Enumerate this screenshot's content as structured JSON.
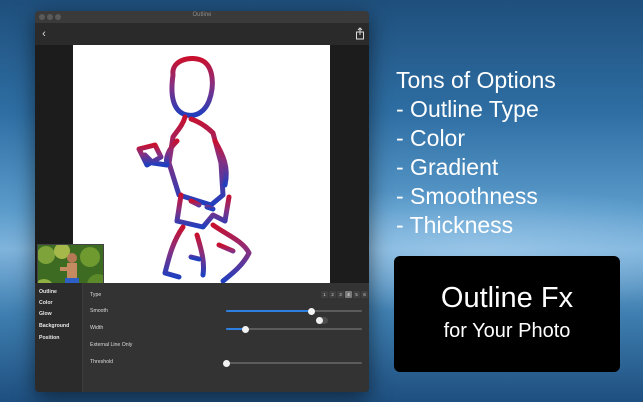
{
  "window": {
    "title": "Outline"
  },
  "toolbar": {
    "back_icon": "chevron-left-icon",
    "share_icon": "share-icon"
  },
  "sidebar": {
    "items": [
      {
        "label": "Outline"
      },
      {
        "label": "Color"
      },
      {
        "label": "Glow"
      },
      {
        "label": "Background"
      },
      {
        "label": "Position"
      }
    ]
  },
  "options": {
    "type": {
      "label": "Type",
      "choices": [
        "1",
        "2",
        "3",
        "4",
        "5",
        "6"
      ],
      "selected": "4"
    },
    "smoothness": {
      "label": "Smooth",
      "value_fraction": 0.63
    },
    "width": {
      "label": "Width",
      "value_fraction": 0.14
    },
    "external_line": {
      "label": "External Line Only",
      "enabled": false
    },
    "threshold": {
      "label": "Threshold",
      "value_fraction": 0.0
    }
  },
  "promo": {
    "lines": [
      "Tons of Options",
      "- Outline Type",
      "- Color",
      "- Gradient",
      "- Smoothness",
      "- Thickness"
    ],
    "badge_title": "Outline Fx",
    "badge_subtitle": "for Your Photo"
  },
  "colors": {
    "accent": "#2f7fe0",
    "outline_gradient_top": "#c8102e",
    "outline_gradient_bottom": "#1f3fbf",
    "badge_background": "#000000"
  }
}
